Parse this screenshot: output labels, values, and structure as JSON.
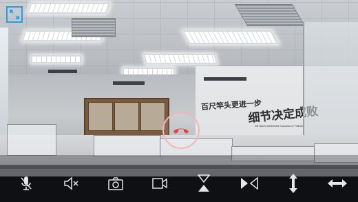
{
  "scene": {
    "wall_slogans": [
      "百尺竿头更进一步",
      "细节决定成败"
    ],
    "wall_sub": "DETAILS Determine Success or Failure"
  },
  "controls": {
    "expand": "expand-icon",
    "hangup": "hang-up-phone-icon",
    "toolbar": [
      {
        "name": "mute-microphone",
        "icon": "mic-off-icon"
      },
      {
        "name": "speaker-mute",
        "icon": "speaker-mute-icon"
      },
      {
        "name": "snapshot",
        "icon": "camera-icon"
      },
      {
        "name": "record-video",
        "icon": "video-record-icon"
      },
      {
        "name": "flip-vertical",
        "icon": "flip-vertical-icon"
      },
      {
        "name": "flip-horizontal",
        "icon": "flip-horizontal-icon"
      },
      {
        "name": "stretch-vertical",
        "icon": "vertical-arrows-icon"
      },
      {
        "name": "stretch-horizontal",
        "icon": "horizontal-arrows-icon"
      }
    ]
  },
  "colors": {
    "accent": "#1aa1e8",
    "hangup": "#e0443e",
    "ring": "#f2b6b6"
  }
}
